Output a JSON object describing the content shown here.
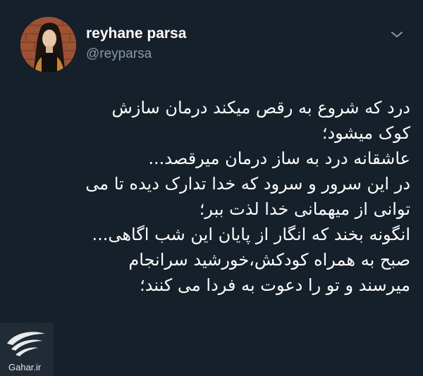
{
  "tweet": {
    "author_name": "reyhane parsa",
    "author_handle": "@reyparsa",
    "body_lines": [
      "درد که شروع به رقص میکند درمان سازش",
      "کوک میشود؛",
      "عاشقانه درد به ساز درمان میرقصد...",
      "در این سرور و سرود که خدا تدارک دیده تا می",
      "توانی از میهمانی خدا لذت ببر؛",
      "انگونه بخند که انگار از پایان این شب اگاهی...",
      "صبح به همراه کودکش،خورشید سرانجام",
      "میرسند و تو را دعوت به فردا می کنند؛"
    ]
  },
  "watermark": {
    "text": "Gahar.ir"
  },
  "colors": {
    "background": "#15202b",
    "secondary_text": "#8899a6",
    "primary_text": "#ffffff"
  },
  "icons": {
    "menu": "chevron-down-icon",
    "logo": "gahar-logo-icon"
  }
}
